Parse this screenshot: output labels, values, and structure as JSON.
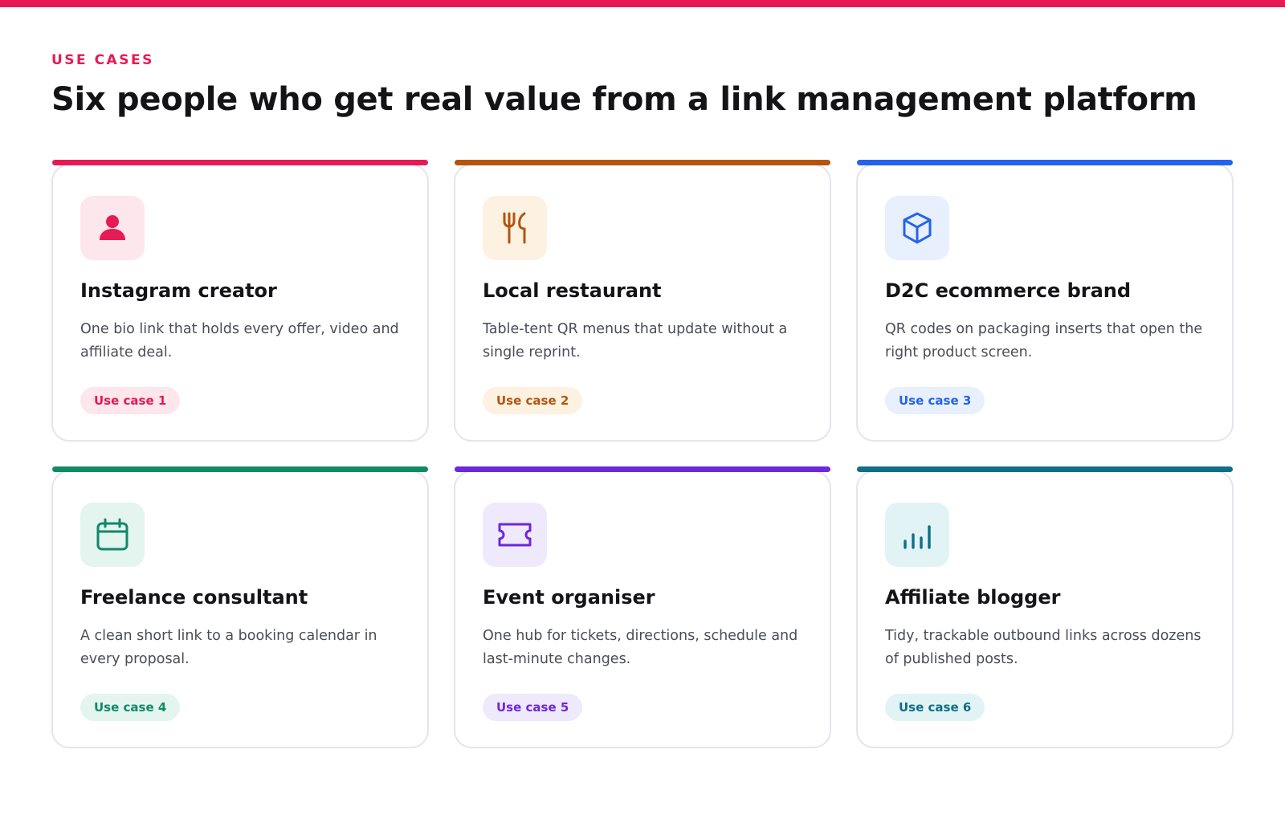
{
  "header": {
    "eyebrow": "USE CASES",
    "title": "Six people who get real value from a link management platform"
  },
  "colors": {
    "top_bar": "#e61a54"
  },
  "cards": [
    {
      "title": "Instagram creator",
      "description": "One bio link that holds every offer, video and affiliate deal.",
      "badge": "Use case 1",
      "icon": "person-icon",
      "accent": "#e61a54",
      "tint": "#fde6ec"
    },
    {
      "title": "Local restaurant",
      "description": "Table-tent QR menus that update without a single reprint.",
      "badge": "Use case 2",
      "icon": "fork-knife-icon",
      "accent": "#b4540f",
      "tint": "#fdf1e1"
    },
    {
      "title": "D2C ecommerce brand",
      "description": "QR codes on packaging inserts that open the right product screen.",
      "badge": "Use case 3",
      "icon": "box-icon",
      "accent": "#2563eb",
      "tint": "#e8effd"
    },
    {
      "title": "Freelance consultant",
      "description": "A clean short link to a booking calendar in every proposal.",
      "badge": "Use case 4",
      "icon": "calendar-icon",
      "accent": "#0f8a66",
      "tint": "#e4f4ee"
    },
    {
      "title": "Event organiser",
      "description": "One hub for tickets, directions, schedule and last-minute changes.",
      "badge": "Use case 5",
      "icon": "ticket-icon",
      "accent": "#6d28d9",
      "tint": "#efe9fc"
    },
    {
      "title": "Affiliate blogger",
      "description": "Tidy, trackable outbound links across dozens of published posts.",
      "badge": "Use case 6",
      "icon": "bar-chart-icon",
      "accent": "#0e6f86",
      "tint": "#e2f3f5"
    }
  ]
}
